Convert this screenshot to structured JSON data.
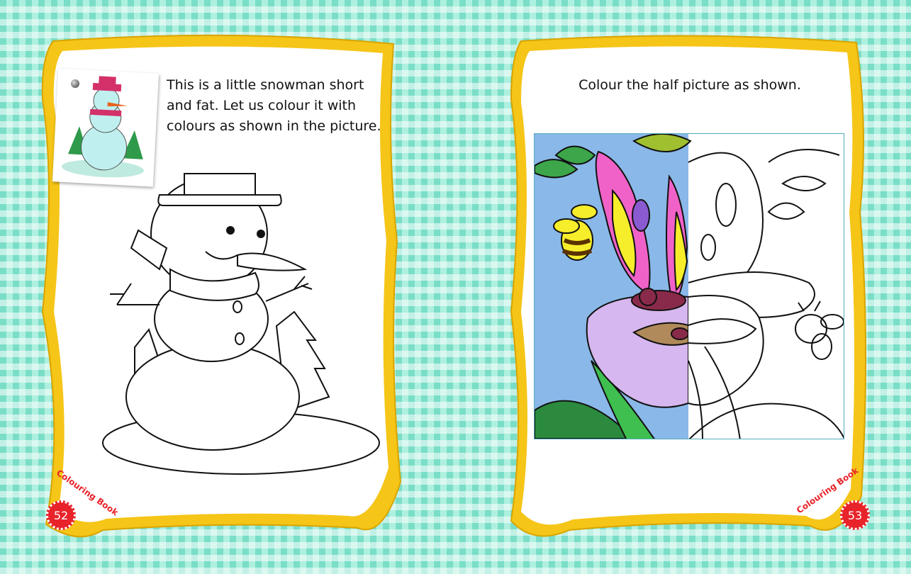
{
  "left_page": {
    "instruction": "This is a little snowman short and fat. Let us colour it with colours as shown in the picture.",
    "page_number": "52",
    "brand": "Colouring Book"
  },
  "right_page": {
    "instruction": "Colour the half picture as shown.",
    "page_number": "53",
    "brand": "Colouring Book"
  },
  "colors": {
    "background": "#aef0df",
    "frame_yellow": "#f5c518",
    "brand_red": "#e8232a",
    "sky_blue": "#8ab8e8",
    "wing_pink": "#f062c8",
    "wing_yellow": "#f6ee2a",
    "petal_lilac": "#d7b7ef"
  },
  "icons": [
    "snowman-illustration",
    "butterfly-illustration",
    "bee-illustration",
    "pushpin-icon"
  ]
}
